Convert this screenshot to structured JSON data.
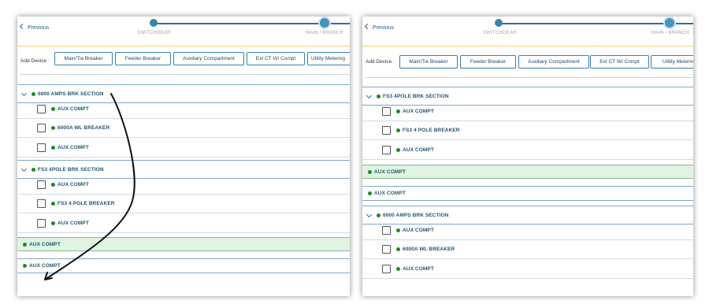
{
  "stepper": {
    "previous": "Previous",
    "step1": "SWITCHGEAR",
    "step2": "MAIN / BRANCH"
  },
  "toolbar": {
    "add_label": "Add Device :",
    "buttons": [
      "Main/Tie Breaker",
      "Feeder Breaker",
      "Auxiliary Compartment",
      "Ext CT W/ Compt",
      "Utility Metering"
    ]
  },
  "left": {
    "sec1": "6000 AMPS BRK SECTION",
    "sec1_items": [
      "AUX COMPT",
      "6000A WL BREAKER",
      "AUX COMPT"
    ],
    "sec2": "FS3 4POLE BRK SECTION",
    "sec2_items": [
      "AUX COMPT",
      "FS3 4 POLE BREAKER",
      "AUX COMPT"
    ],
    "aux_hl": "AUX COMPT",
    "aux_plain": "AUX COMPT"
  },
  "right": {
    "sec1": "FS3 4POLE BRK SECTION",
    "sec1_items": [
      "AUX COMPT",
      "FS3 4 POLE BREAKER",
      "AUX COMPT"
    ],
    "aux_hl": "AUX COMPT",
    "aux_plain": "AUX COMPT",
    "sec2": "6000 AMPS BRK SECTION",
    "sec2_items": [
      "AUX COMPT",
      "6000A WL BREAKER",
      "AUX COMPT"
    ]
  },
  "colors": {
    "accent": "#2e6f96",
    "status_dot": "#1e8a27",
    "highlight_row": "#dff4e1",
    "divider_yellow": "#f0d27a"
  },
  "icons": [
    "chevron-left-icon",
    "chevron-down-icon",
    "status-dot-icon",
    "checkbox-icon",
    "arrow-annotation"
  ]
}
